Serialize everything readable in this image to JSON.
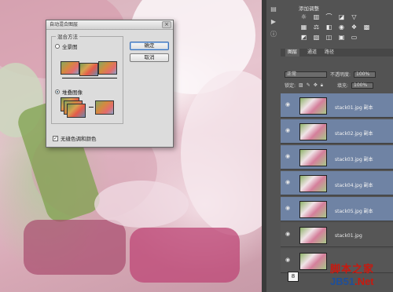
{
  "dialog": {
    "title": "自动混合图层",
    "close_glyph": "×",
    "group_label": "混合方法",
    "option_panorama": "全景图",
    "option_stack": "堆叠图像",
    "ok": "确定",
    "cancel": "取消",
    "checkbox_label": "无缝色调和颜色",
    "checkbox_mark": "✓"
  },
  "adjustments": {
    "title": "添加调整"
  },
  "layers_panel": {
    "tabs": [
      "图层",
      "通道",
      "路径"
    ],
    "blend_mode": "正常",
    "opacity_label": "不透明度:",
    "opacity_value": "100%",
    "lock_label": "锁定:",
    "fill_label": "填充:",
    "fill_value": "100%",
    "layers": [
      {
        "name": "stack01.jpg 副本",
        "selected": true
      },
      {
        "name": "stack02.jpg 副本",
        "selected": true
      },
      {
        "name": "stack03.jpg 副本",
        "selected": true
      },
      {
        "name": "stack04.jpg 副本",
        "selected": true
      },
      {
        "name": "stack05.jpg 副本",
        "selected": true
      },
      {
        "name": "stack01.jpg",
        "selected": false
      }
    ]
  },
  "step_badge": "8",
  "watermark": {
    "chinese": "脚本之家",
    "url_main": "JB51",
    "url_tail": ".Net"
  },
  "colors": {
    "panel_bg": "#535353",
    "selected_layer": "#6f83a4",
    "watermark_red": "#c8190f"
  },
  "icons": [
    "close-icon",
    "eye-icon",
    "adjustment-icons",
    "lock-icon"
  ]
}
